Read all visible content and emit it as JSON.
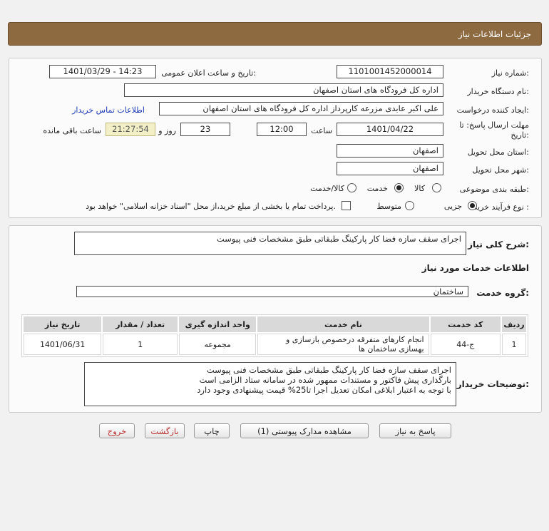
{
  "header": {
    "title": "جزئیات اطلاعات نیاز"
  },
  "form": {
    "need_number_label": "شماره نیاز:",
    "need_number": "1101001452000014",
    "announce_label": "تاریخ و ساعت اعلان عمومی:",
    "announce_value": "1401/03/29 - 14:23",
    "buyer_org_label": "نام دستگاه خریدار:",
    "buyer_org": "اداره کل فرودگاه های استان اصفهان",
    "creator_label": "ایجاد کننده درخواست:",
    "creator": "علی اکبر عابدی مزرعه کارپرداز اداره کل فرودگاه های استان اصفهان",
    "contact_link": "اطلاعات تماس خریدار",
    "deadline_label_1": "مهلت ارسال پاسخ: تا",
    "deadline_label_2": "تاریخ:",
    "deadline_date": "1401/04/22",
    "time_label": "ساعت",
    "deadline_time": "12:00",
    "days_value": "23",
    "days_label": "روز و",
    "remaining_time": "21:27:54",
    "remaining_label": "ساعت باقی مانده",
    "province_label": "استان محل تحویل:",
    "province": "اصفهان",
    "city_label": "شهر محل تحویل:",
    "city": "اصفهان",
    "category_label": "طبقه بندی موضوعی:",
    "category_options": [
      "کالا",
      "خدمت",
      "کالا/خدمت"
    ],
    "category_selected": 1,
    "process_label": "نوع فرآیند خرید :",
    "process_options": [
      "جزیی",
      "متوسط"
    ],
    "process_selected": 0,
    "payment_note": "پرداخت تمام یا بخشی از مبلغ خرید،از محل \"اسناد خزانه اسلامی\" خواهد بود."
  },
  "summary": {
    "label": "شرح کلی نیاز:",
    "value": "اجرای سقف سازه فضا کار پارکینگ طبقاتی طبق مشخصات فنی پیوست"
  },
  "services": {
    "section_title": "اطلاعات خدمات مورد نیاز",
    "group_label": "گروه خدمت:",
    "group_value": "ساختمان"
  },
  "table": {
    "headers": [
      "ردیف",
      "کد خدمت",
      "نام خدمت",
      "واحد اندازه گیری",
      "تعداد / مقدار",
      "تاریخ نیاز"
    ],
    "rows": [
      [
        "1",
        "ج-44",
        "انجام کارهای متفرقه درخصوص بازسازی و بهسازی ساختمان ها",
        "مجموعه",
        "1",
        "1401/06/31"
      ]
    ]
  },
  "buyer_notes": {
    "label": "توضیحات خریدار:",
    "lines": [
      "اجرای سقف سازه فضا کار پارکینگ طبقاتی طبق مشخصات فنی پیوست",
      "بارگذاری پیش فاکتور و مستندات ممهور شده در سامانه ستاد الزامی است",
      "با توجه به اعتبار ابلاغی امکان تعدیل اجرا تا25% قیمت پیشنهادی وجود دارد"
    ]
  },
  "buttons": {
    "reply": "پاسخ به نیاز",
    "attachments": "مشاهده مدارک پیوستی (1)",
    "print": "چاپ",
    "back": "بازگشت",
    "exit": "خروج"
  }
}
